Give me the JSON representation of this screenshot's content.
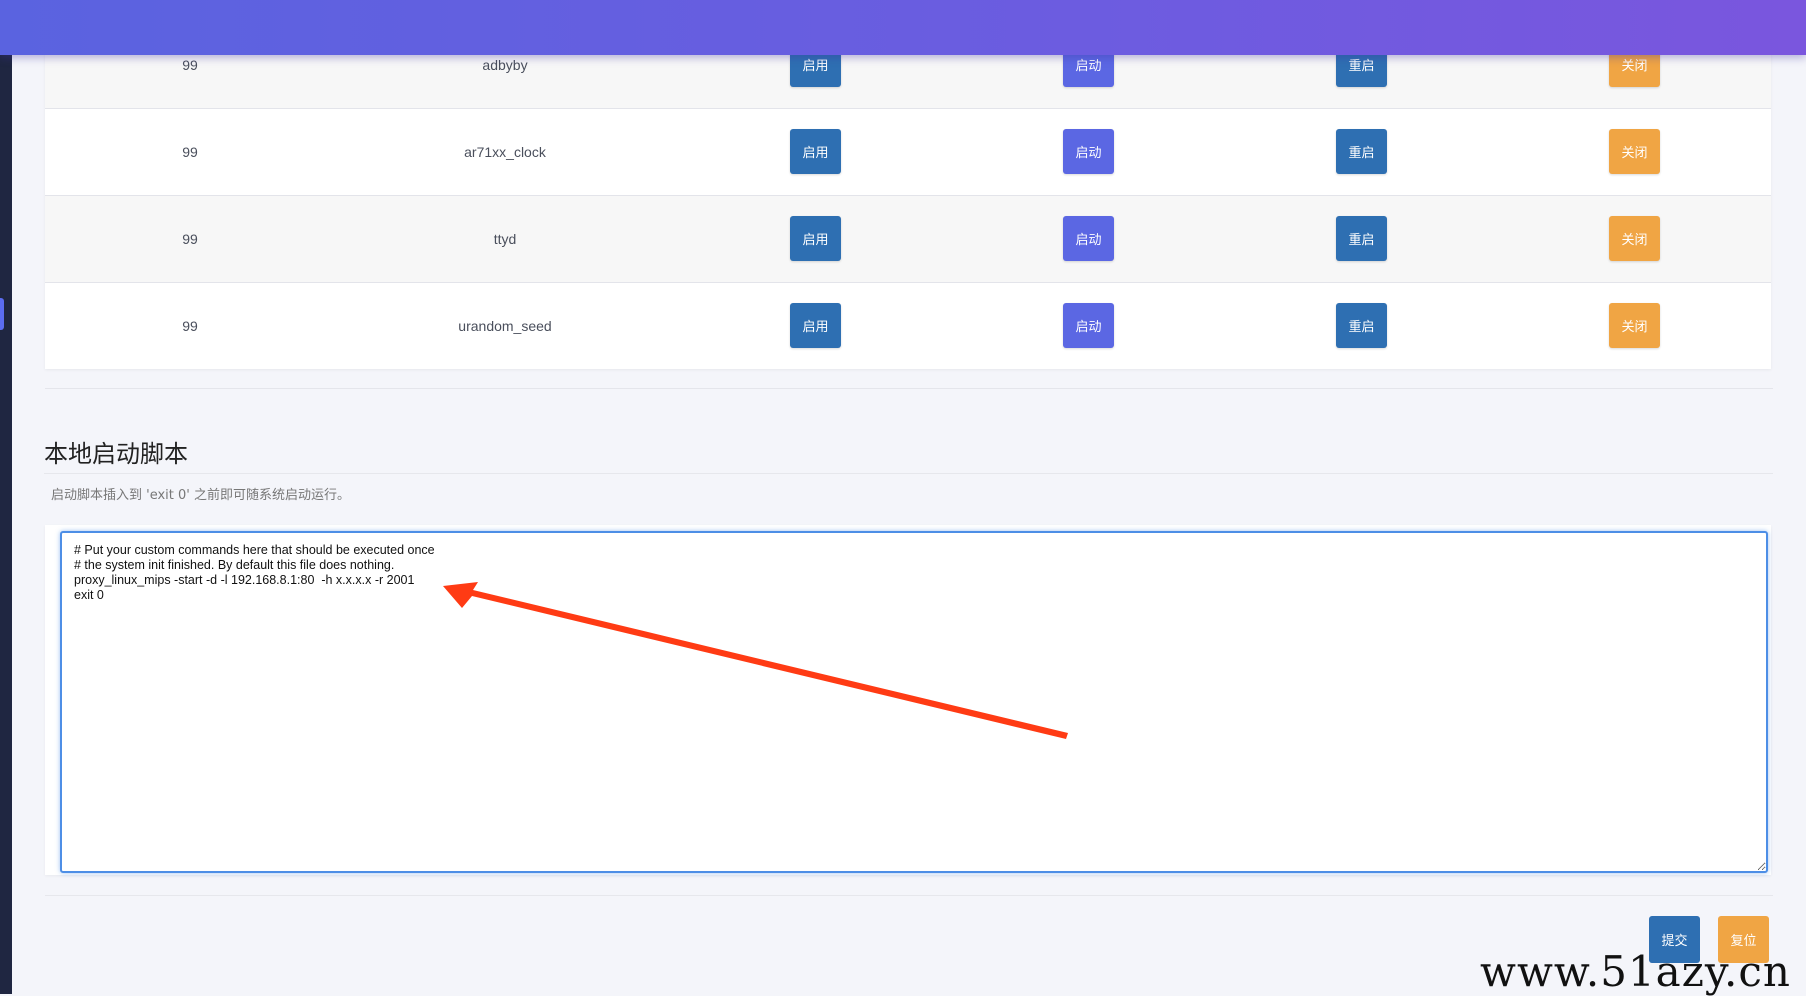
{
  "services": [
    {
      "priority": "99",
      "name": "adbyby"
    },
    {
      "priority": "99",
      "name": "ar71xx_clock"
    },
    {
      "priority": "99",
      "name": "ttyd"
    },
    {
      "priority": "99",
      "name": "urandom_seed"
    }
  ],
  "row_actions": {
    "enable_label": "启用",
    "start_label": "启动",
    "restart_label": "重启",
    "stop_label": "关闭"
  },
  "local_startup": {
    "title": "本地启动脚本",
    "description": "启动脚本插入到 'exit 0' 之前即可随系统启动运行。",
    "script": "# Put your custom commands here that should be executed once\n# the system init finished. By default this file does nothing.\nproxy_linux_mips -start -d -l 192.168.8.1:80  -h x.x.x.x -r 2001\nexit 0\n"
  },
  "form_actions": {
    "submit_label": "提交",
    "reset_label": "复位"
  },
  "watermark": "www.51azy.cn",
  "colors": {
    "header_start": "#5a63e0",
    "header_end": "#7a56de",
    "primary_blue": "#2e6fb2",
    "start_purple": "#5b67e3",
    "warning_orange": "#f0a544",
    "annotation_arrow": "#ff3b14"
  }
}
